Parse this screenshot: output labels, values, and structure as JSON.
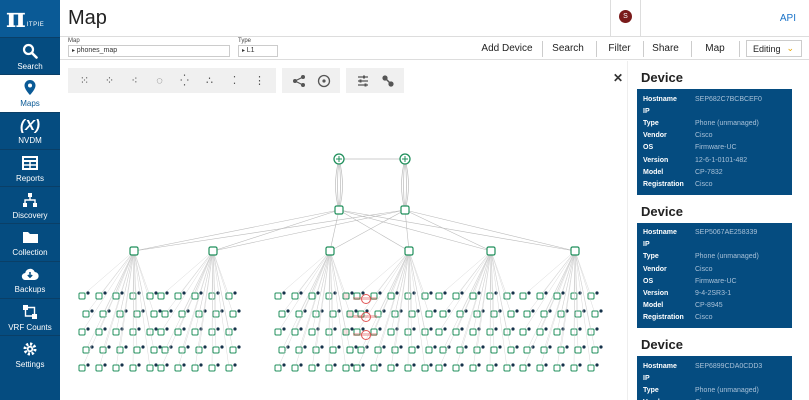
{
  "app": {
    "logo_text": "ITPIE",
    "title": "Map",
    "avatar_initial": "S",
    "api_label": "API"
  },
  "sidebar": {
    "items": [
      {
        "label": "Search",
        "icon": "search-icon"
      },
      {
        "label": "Maps",
        "icon": "map-pin-icon",
        "active": true
      },
      {
        "label": "NVDM",
        "icon": "variable-x-icon",
        "glyph": "(X)"
      },
      {
        "label": "Reports",
        "icon": "table-icon"
      },
      {
        "label": "Discovery",
        "icon": "network-tree-icon"
      },
      {
        "label": "Collection",
        "icon": "folder-icon"
      },
      {
        "label": "Backups",
        "icon": "cloud-download-icon"
      },
      {
        "label": "VRF Counts",
        "icon": "vrf-icon"
      },
      {
        "label": "Settings",
        "icon": "gear-icon"
      }
    ]
  },
  "toolbar": {
    "map_label": "Map",
    "map_value": "phones_map",
    "type_label": "Type",
    "type_value": "L1",
    "buttons": [
      "Add Device",
      "Search",
      "Filter",
      "Share",
      "Map"
    ],
    "mode": "Editing"
  },
  "graph_tools": [
    "grid-layout-icon",
    "scatter-layout-icon",
    "cluster-layout-icon",
    "circle-layout-icon",
    "radial-layout-icon",
    "triangle-layout-icon",
    "spread-layout-icon",
    "tree-layout-icon",
    "share-nodes-icon",
    "target-icon",
    "sliders-icon",
    "connect-nodes-icon"
  ],
  "colors": {
    "sidebar": "#054c80",
    "accent": "#1a73c8",
    "node": "#1f8f5b",
    "highlight": "#e05555",
    "panel_box": "#054c80"
  },
  "panel": {
    "devices": [
      {
        "title": "Device",
        "fields": [
          {
            "k": "Hostname",
            "v": "SEP682C7BCBCEF0"
          },
          {
            "k": "IP",
            "v": ""
          },
          {
            "k": "Type",
            "v": "Phone (unmanaged)"
          },
          {
            "k": "Vendor",
            "v": "Cisco"
          },
          {
            "k": "OS",
            "v": "Firmware-UC"
          },
          {
            "k": "Version",
            "v": "12-6-1-0101-482"
          },
          {
            "k": "Model",
            "v": "CP-7832"
          },
          {
            "k": "Registration",
            "v": "Cisco"
          }
        ]
      },
      {
        "title": "Device",
        "fields": [
          {
            "k": "Hostname",
            "v": "SEP5067AE258339"
          },
          {
            "k": "IP",
            "v": ""
          },
          {
            "k": "Type",
            "v": "Phone (unmanaged)"
          },
          {
            "k": "Vendor",
            "v": "Cisco"
          },
          {
            "k": "OS",
            "v": "Firmware-UC"
          },
          {
            "k": "Version",
            "v": "9-4-2SR3-1"
          },
          {
            "k": "Model",
            "v": "CP-8945"
          },
          {
            "k": "Registration",
            "v": "Cisco"
          }
        ]
      },
      {
        "title": "Device",
        "fields": [
          {
            "k": "Hostname",
            "v": "SEP6899CDA0CDD3"
          },
          {
            "k": "IP",
            "v": ""
          },
          {
            "k": "Type",
            "v": "Phone (unmanaged)"
          },
          {
            "k": "Vendor",
            "v": "Cisco"
          }
        ]
      }
    ]
  }
}
